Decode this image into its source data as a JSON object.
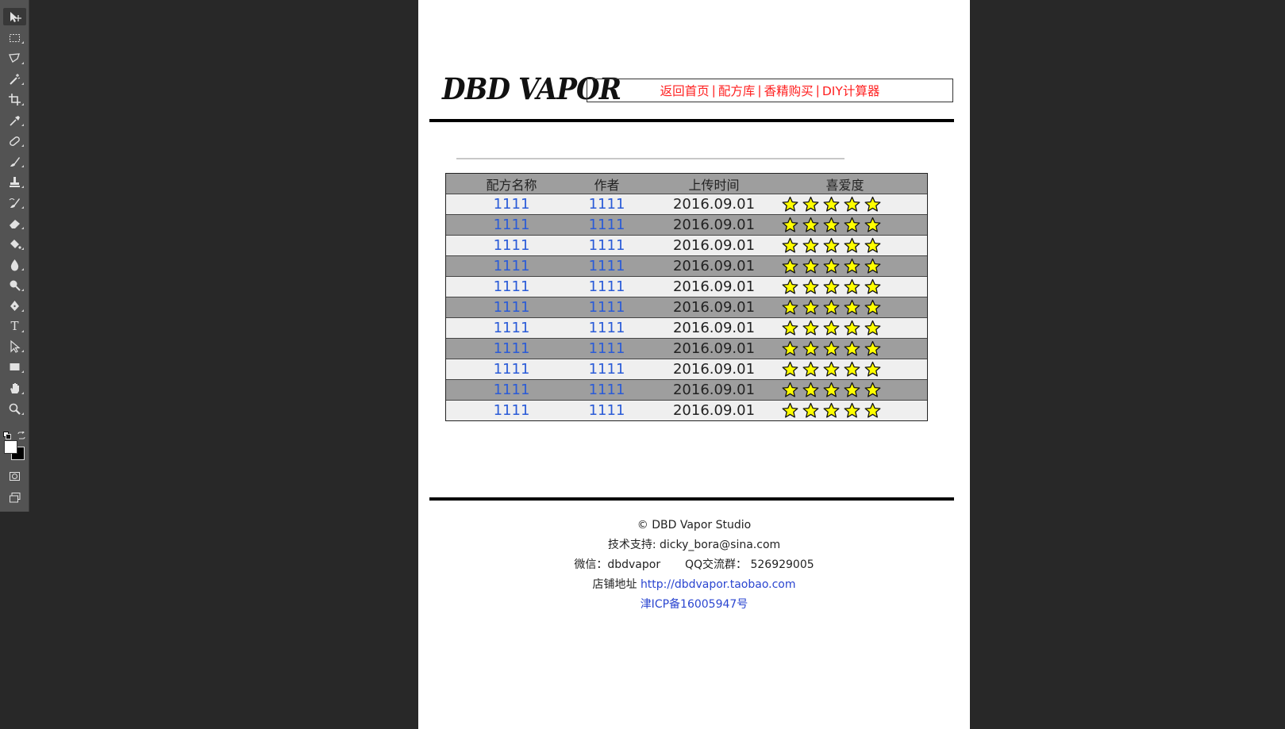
{
  "toolbar": {
    "tools": [
      {
        "name": "move-tool",
        "icon": "move-icon",
        "active": true
      },
      {
        "name": "marquee-tool",
        "icon": "rectangular-marquee-icon"
      },
      {
        "name": "lasso-tool",
        "icon": "polygonal-lasso-icon"
      },
      {
        "name": "magic-wand-tool",
        "icon": "magic-wand-icon"
      },
      {
        "name": "crop-tool",
        "icon": "crop-icon"
      },
      {
        "name": "eyedropper-tool",
        "icon": "eyedropper-icon"
      },
      {
        "name": "healing-brush-tool",
        "icon": "bandage-icon"
      },
      {
        "name": "brush-tool",
        "icon": "brush-icon"
      },
      {
        "name": "clone-stamp-tool",
        "icon": "stamp-icon"
      },
      {
        "name": "history-brush-tool",
        "icon": "history-brush-icon"
      },
      {
        "name": "eraser-tool",
        "icon": "eraser-icon"
      },
      {
        "name": "paint-bucket-tool",
        "icon": "paint-bucket-icon"
      },
      {
        "name": "blur-tool",
        "icon": "water-drop-icon"
      },
      {
        "name": "dodge-tool",
        "icon": "dodge-icon"
      },
      {
        "name": "pen-tool",
        "icon": "pen-nib-icon"
      },
      {
        "name": "type-tool",
        "icon": "type-icon",
        "glyph": "T"
      },
      {
        "name": "path-selection-tool",
        "icon": "arrow-pointer-icon"
      },
      {
        "name": "rectangle-tool",
        "icon": "rectangle-icon"
      },
      {
        "name": "hand-tool",
        "icon": "hand-icon"
      },
      {
        "name": "zoom-tool",
        "icon": "magnifier-icon"
      }
    ],
    "foreground_color": "#ffffff",
    "background_color": "#000000"
  },
  "site": {
    "logo": "DBD VAPOR",
    "nav": [
      {
        "label": "返回首页"
      },
      {
        "label": "配方库"
      },
      {
        "label": "香精购买"
      },
      {
        "label": "DIY计算器"
      }
    ],
    "nav_separator": "|",
    "nav_color": "#ff2020"
  },
  "table": {
    "headers": {
      "name": "配方名称",
      "author": "作者",
      "date": "上传时间",
      "rating": "喜爱度"
    },
    "rows": [
      {
        "name": "1111",
        "author": "1111",
        "date": "2016.09.01",
        "stars": 5
      },
      {
        "name": "1111",
        "author": "1111",
        "date": "2016.09.01",
        "stars": 5
      },
      {
        "name": "1111",
        "author": "1111",
        "date": "2016.09.01",
        "stars": 5
      },
      {
        "name": "1111",
        "author": "1111",
        "date": "2016.09.01",
        "stars": 5
      },
      {
        "name": "1111",
        "author": "1111",
        "date": "2016.09.01",
        "stars": 5
      },
      {
        "name": "1111",
        "author": "1111",
        "date": "2016.09.01",
        "stars": 5
      },
      {
        "name": "1111",
        "author": "1111",
        "date": "2016.09.01",
        "stars": 5
      },
      {
        "name": "1111",
        "author": "1111",
        "date": "2016.09.01",
        "stars": 5
      },
      {
        "name": "1111",
        "author": "1111",
        "date": "2016.09.01",
        "stars": 5
      },
      {
        "name": "1111",
        "author": "1111",
        "date": "2016.09.01",
        "stars": 5
      },
      {
        "name": "1111",
        "author": "1111",
        "date": "2016.09.01",
        "stars": 5
      }
    ],
    "link_color": "#2a5bd7",
    "star_color": "#ffff00"
  },
  "footer": {
    "copyright": "© DBD Vapor Studio",
    "support": "技术支持: dicky_bora@sina.com",
    "wechat": "微信：dbdvapor",
    "qq": "QQ交流群： 526929005",
    "shop_label": "店铺地址",
    "shop_url": "http://dbdvapor.taobao.com",
    "icp": "津ICP备16005947号"
  }
}
